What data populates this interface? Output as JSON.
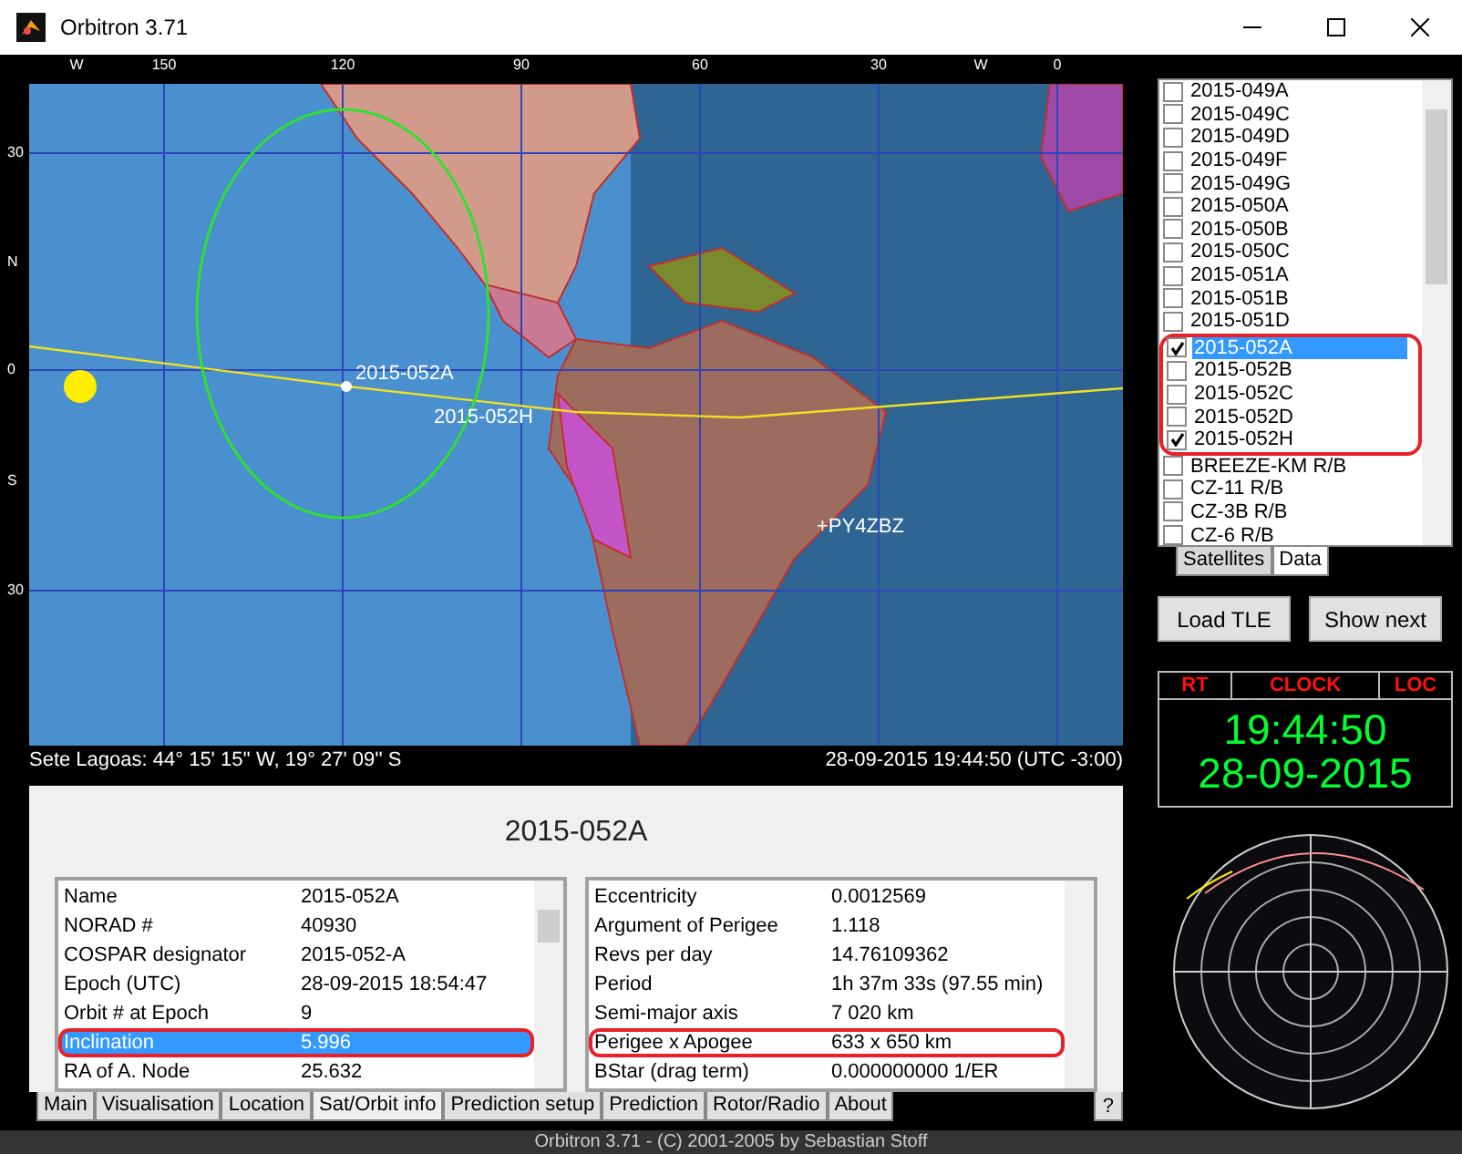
{
  "window": {
    "title": "Orbitron 3.71"
  },
  "map": {
    "top_ticks": [
      "W",
      "150",
      "120",
      "90",
      "60",
      "30",
      "W",
      "0"
    ],
    "left_ticks": [
      "30",
      "N",
      "0",
      "S",
      "30"
    ],
    "labels": [
      {
        "kind": "satellite",
        "text": "2015-052A"
      },
      {
        "kind": "satellite",
        "text": "2015-052H"
      },
      {
        "kind": "station",
        "text": "+PY4ZBZ"
      }
    ],
    "location": "Sete Lagoas: 44° 15' 15'' W, 19° 27' 09'' S",
    "datetime": "28-09-2015 19:44:50 (UTC -3:00)"
  },
  "info": {
    "title": "2015-052A",
    "left_rows": [
      {
        "label": "Name",
        "value": "2015-052A",
        "selected": false,
        "circled": false
      },
      {
        "label": "NORAD #",
        "value": "40930",
        "selected": false,
        "circled": false
      },
      {
        "label": "COSPAR designator",
        "value": "2015-052-A",
        "selected": false,
        "circled": false
      },
      {
        "label": "Epoch (UTC)",
        "value": "28-09-2015 18:54:47",
        "selected": false,
        "circled": false
      },
      {
        "label": "Orbit # at Epoch",
        "value": "9",
        "selected": false,
        "circled": false
      },
      {
        "label": "Inclination",
        "value": "5.996",
        "selected": true,
        "circled": true
      },
      {
        "label": "RA of A. Node",
        "value": "25.632",
        "selected": false,
        "circled": false
      }
    ],
    "right_rows": [
      {
        "label": "Eccentricity",
        "value": "0.0012569",
        "selected": false,
        "circled": false
      },
      {
        "label": "Argument of Perigee",
        "value": "1.118",
        "selected": false,
        "circled": false
      },
      {
        "label": "Revs per day",
        "value": "14.76109362",
        "selected": false,
        "circled": false
      },
      {
        "label": "Period",
        "value": "1h 37m 33s (97.55 min)",
        "selected": false,
        "circled": false
      },
      {
        "label": "Semi-major axis",
        "value": "7 020 km",
        "selected": false,
        "circled": false
      },
      {
        "label": "Perigee x Apogee",
        "value": "633 x 650 km",
        "selected": false,
        "circled": true
      },
      {
        "label": "BStar (drag term)",
        "value": "0.000000000 1/ER",
        "selected": false,
        "circled": false
      }
    ]
  },
  "bottom_tabs": [
    {
      "label": "Main",
      "selected": false
    },
    {
      "label": "Visualisation",
      "selected": false
    },
    {
      "label": "Location",
      "selected": false
    },
    {
      "label": "Sat/Orbit info",
      "selected": true
    },
    {
      "label": "Prediction setup",
      "selected": false
    },
    {
      "label": "Prediction",
      "selected": false
    },
    {
      "label": "Rotor/Radio",
      "selected": false
    },
    {
      "label": "About",
      "selected": false
    }
  ],
  "help_tab": "?",
  "satellites": [
    {
      "name": "2015-049A",
      "checked": false,
      "selected": false,
      "circled": false
    },
    {
      "name": "2015-049C",
      "checked": false,
      "selected": false,
      "circled": false
    },
    {
      "name": "2015-049D",
      "checked": false,
      "selected": false,
      "circled": false
    },
    {
      "name": "2015-049F",
      "checked": false,
      "selected": false,
      "circled": false
    },
    {
      "name": "2015-049G",
      "checked": false,
      "selected": false,
      "circled": false
    },
    {
      "name": "2015-050A",
      "checked": false,
      "selected": false,
      "circled": false
    },
    {
      "name": "2015-050B",
      "checked": false,
      "selected": false,
      "circled": false
    },
    {
      "name": "2015-050C",
      "checked": false,
      "selected": false,
      "circled": false
    },
    {
      "name": "2015-051A",
      "checked": false,
      "selected": false,
      "circled": false
    },
    {
      "name": "2015-051B",
      "checked": false,
      "selected": false,
      "circled": false
    },
    {
      "name": "2015-051D",
      "checked": false,
      "selected": false,
      "circled": false
    },
    {
      "name": "2015-052A",
      "checked": true,
      "selected": true,
      "circled": true
    },
    {
      "name": "2015-052B",
      "checked": false,
      "selected": false,
      "circled": true
    },
    {
      "name": "2015-052C",
      "checked": false,
      "selected": false,
      "circled": true
    },
    {
      "name": "2015-052D",
      "checked": false,
      "selected": false,
      "circled": true
    },
    {
      "name": "2015-052H",
      "checked": true,
      "selected": false,
      "circled": true
    },
    {
      "name": "BREEZE-KM R/B",
      "checked": false,
      "selected": false,
      "circled": false
    },
    {
      "name": "CZ-11 R/B",
      "checked": false,
      "selected": false,
      "circled": false
    },
    {
      "name": "CZ-3B R/B",
      "checked": false,
      "selected": false,
      "circled": false
    },
    {
      "name": "CZ-6 R/B",
      "checked": false,
      "selected": false,
      "circled": false
    }
  ],
  "list_tabs": [
    {
      "label": "Satellites",
      "selected": false
    },
    {
      "label": "Data",
      "selected": true
    }
  ],
  "buttons": [
    "Load TLE",
    "Show next"
  ],
  "clock": {
    "headers": [
      "RT",
      "CLOCK",
      "LOC"
    ],
    "time": "19:44:50",
    "date": "28-09-2015"
  },
  "status_bar": "Orbitron 3.71 - (C) 2001-2005 by Sebastian Stoff"
}
